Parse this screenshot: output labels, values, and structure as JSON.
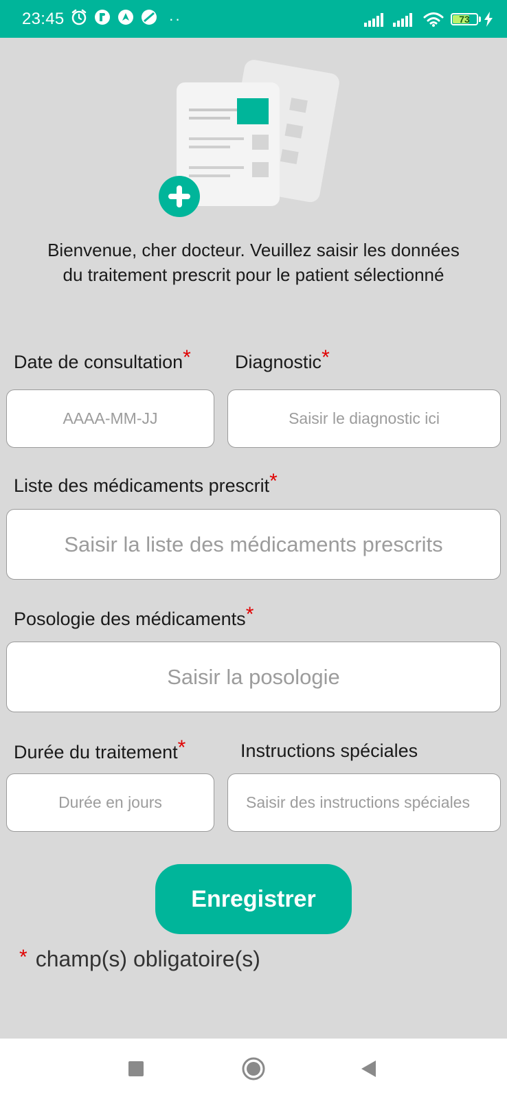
{
  "status_bar": {
    "time": "23:45",
    "dots": "··",
    "battery_level": "73",
    "battery_fraction": 0.73
  },
  "colors": {
    "accent": "#00b59a",
    "required": "#e00000",
    "background": "#d9d9d9"
  },
  "welcome_text": "Bienvenue, cher docteur. Veuillez saisir les données du traitement prescrit pour le patient sélectionné",
  "form": {
    "required_marker": "*",
    "date": {
      "label": "Date de consultation",
      "placeholder": "AAAA-MM-JJ"
    },
    "diagnostic": {
      "label": "Diagnostic",
      "placeholder": "Saisir le diagnostic ici"
    },
    "medications": {
      "label": "Liste des médicaments prescrit",
      "placeholder": "Saisir la liste des médicaments prescrits"
    },
    "posology": {
      "label": "Posologie des médicaments",
      "placeholder": "Saisir la posologie"
    },
    "duration": {
      "label": "Durée du traitement",
      "placeholder": "Durée en jours"
    },
    "instructions": {
      "label": "Instructions spéciales",
      "placeholder": "Saisir des instructions spéciales"
    },
    "save_label": "Enregistrer",
    "footnote": "champ(s) obligatoire(s)"
  },
  "icons": {
    "hero": "add-document-icon",
    "nav_recents": "square-icon",
    "nav_home": "circle-icon",
    "nav_back": "triangle-back-icon"
  }
}
